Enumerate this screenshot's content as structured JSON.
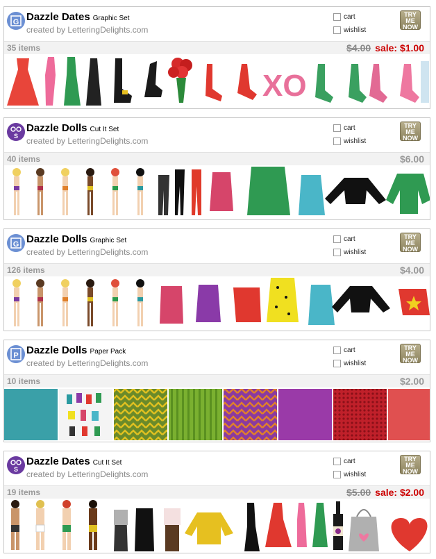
{
  "colors": {
    "sale": "#cc0000",
    "muted": "#999999",
    "badge_graphic": "#6b8fd3",
    "badge_cut": "#6a3aa0"
  },
  "products": [
    {
      "title": "Dazzle Dates",
      "kind": "Graphic Set",
      "badge_icon": "graphic-set-icon",
      "creator": "created by LetteringDelights.com",
      "cart_label": "cart",
      "wishlist_label": "wishlist",
      "try_label": "TRY ME NOW",
      "item_count": "35 items",
      "old_price": "$4.00",
      "sale_label": "sale: $1.00"
    },
    {
      "title": "Dazzle Dolls",
      "kind": "Cut It Set",
      "badge_icon": "cut-it-set-icon",
      "creator": "created by LetteringDelights.com",
      "cart_label": "cart",
      "wishlist_label": "wishlist",
      "try_label": "TRY ME NOW",
      "item_count": "40 items",
      "price": "$6.00"
    },
    {
      "title": "Dazzle Dolls",
      "kind": "Graphic Set",
      "badge_icon": "graphic-set-icon",
      "creator": "created by LetteringDelights.com",
      "cart_label": "cart",
      "wishlist_label": "wishlist",
      "try_label": "TRY ME NOW",
      "item_count": "126 items",
      "price": "$4.00"
    },
    {
      "title": "Dazzle Dolls",
      "kind": "Paper Pack",
      "badge_icon": "paper-pack-icon",
      "creator": "created by LetteringDelights.com",
      "cart_label": "cart",
      "wishlist_label": "wishlist",
      "try_label": "TRY ME NOW",
      "item_count": "10 items",
      "price": "$2.00"
    },
    {
      "title": "Dazzle Dates",
      "kind": "Cut It Set",
      "badge_icon": "cut-it-set-icon",
      "creator": "created by LetteringDelights.com",
      "cart_label": "cart",
      "wishlist_label": "wishlist",
      "try_label": "TRY ME NOW",
      "item_count": "19 items",
      "old_price": "$5.00",
      "sale_label": "sale: $2.00"
    }
  ],
  "preview_text": {
    "xo": "XO"
  }
}
